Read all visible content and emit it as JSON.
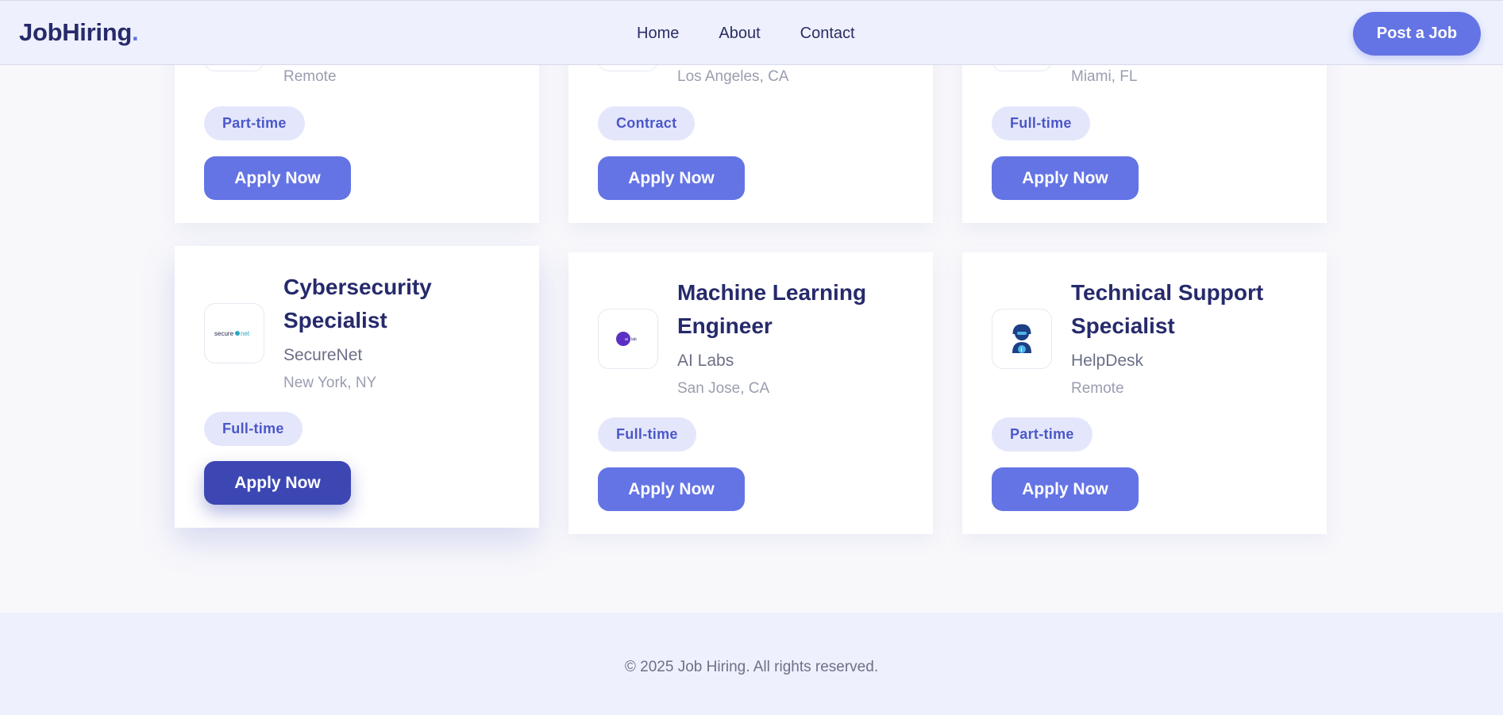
{
  "header": {
    "logo_text": "JobHiring",
    "logo_dot": ".",
    "nav": [
      "Home",
      "About",
      "Contact"
    ],
    "post_button": "Post a Job"
  },
  "jobs_top": [
    {
      "location": "Remote",
      "type": "Part-time",
      "apply": "Apply Now"
    },
    {
      "location": "Los Angeles, CA",
      "type": "Contract",
      "apply": "Apply Now"
    },
    {
      "location": "Miami, FL",
      "type": "Full-time",
      "apply": "Apply Now"
    }
  ],
  "jobs": [
    {
      "title": "Cybersecurity Specialist",
      "company": "SecureNet",
      "location": "New York, NY",
      "type": "Full-time",
      "apply": "Apply Now",
      "logo": "securenet-logo",
      "logo_text": "secure net"
    },
    {
      "title": "Machine Learning Engineer",
      "company": "AI Labs",
      "location": "San Jose, CA",
      "type": "Full-time",
      "apply": "Apply Now",
      "logo": "ai-labs-logo",
      "logo_text": "ai lab"
    },
    {
      "title": "Technical Support Specialist",
      "company": "HelpDesk",
      "location": "Remote",
      "type": "Part-time",
      "apply": "Apply Now",
      "logo": "helpdesk-logo"
    }
  ],
  "footer": {
    "copyright": "© 2025 Job Hiring. All rights reserved."
  },
  "colors": {
    "accent": "#6474e5",
    "accent_active": "#3c47b4",
    "title": "#262a6b",
    "tag_bg": "#e4e7fb"
  }
}
